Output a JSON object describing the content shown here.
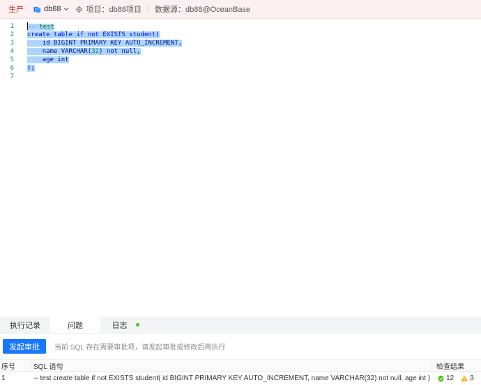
{
  "topbar": {
    "env": "生产",
    "db": "db88",
    "project": "项目：db88项目",
    "datasource": "数据源：db88@OceanBase"
  },
  "editor": {
    "lines": [
      {
        "no": "1",
        "parts": [
          {
            "t": "-- test",
            "c": "cm"
          }
        ]
      },
      {
        "no": "2",
        "parts": [
          {
            "t": "create table if not EXISTS student(",
            "c": "kw"
          }
        ]
      },
      {
        "no": "3",
        "parts": [
          {
            "t": "····",
            "c": "ws"
          },
          {
            "t": "id BIGINT PRIMARY KEY AUTO_INCREMENT,",
            "c": "tx"
          }
        ]
      },
      {
        "no": "4",
        "parts": [
          {
            "t": "····",
            "c": "ws"
          },
          {
            "t": "name VARCHAR(",
            "c": "tx"
          },
          {
            "t": "32",
            "c": "num"
          },
          {
            "t": ") not null,",
            "c": "tx"
          }
        ]
      },
      {
        "no": "5",
        "parts": [
          {
            "t": "····",
            "c": "ws"
          },
          {
            "t": "age int",
            "c": "tx"
          }
        ]
      },
      {
        "no": "6",
        "parts": [
          {
            "t": ");",
            "c": "tx"
          }
        ]
      },
      {
        "no": "7",
        "parts": []
      }
    ]
  },
  "panel": {
    "tabs": [
      "执行记录",
      "问题",
      "日志"
    ],
    "active_tab": 1,
    "submit_button": "发起审批",
    "hint": "当前 SQL 存在需要审批项，请发起审批或修改后再执行",
    "columns": {
      "no": "序号",
      "sql": "SQL 语句",
      "result": "检查结果"
    },
    "rows": [
      {
        "no": "1",
        "sql": "-- test create table if not EXISTS student( id BIGINT PRIMARY KEY AUTO_INCREMENT, name VARCHAR(32) not null, age int )",
        "passed": "12",
        "warnings": "3"
      }
    ]
  },
  "colors": {
    "primary": "#1677ff",
    "env": "#e2231a",
    "success": "#52c41a",
    "warning": "#faad14",
    "selection": "#add6ff"
  }
}
